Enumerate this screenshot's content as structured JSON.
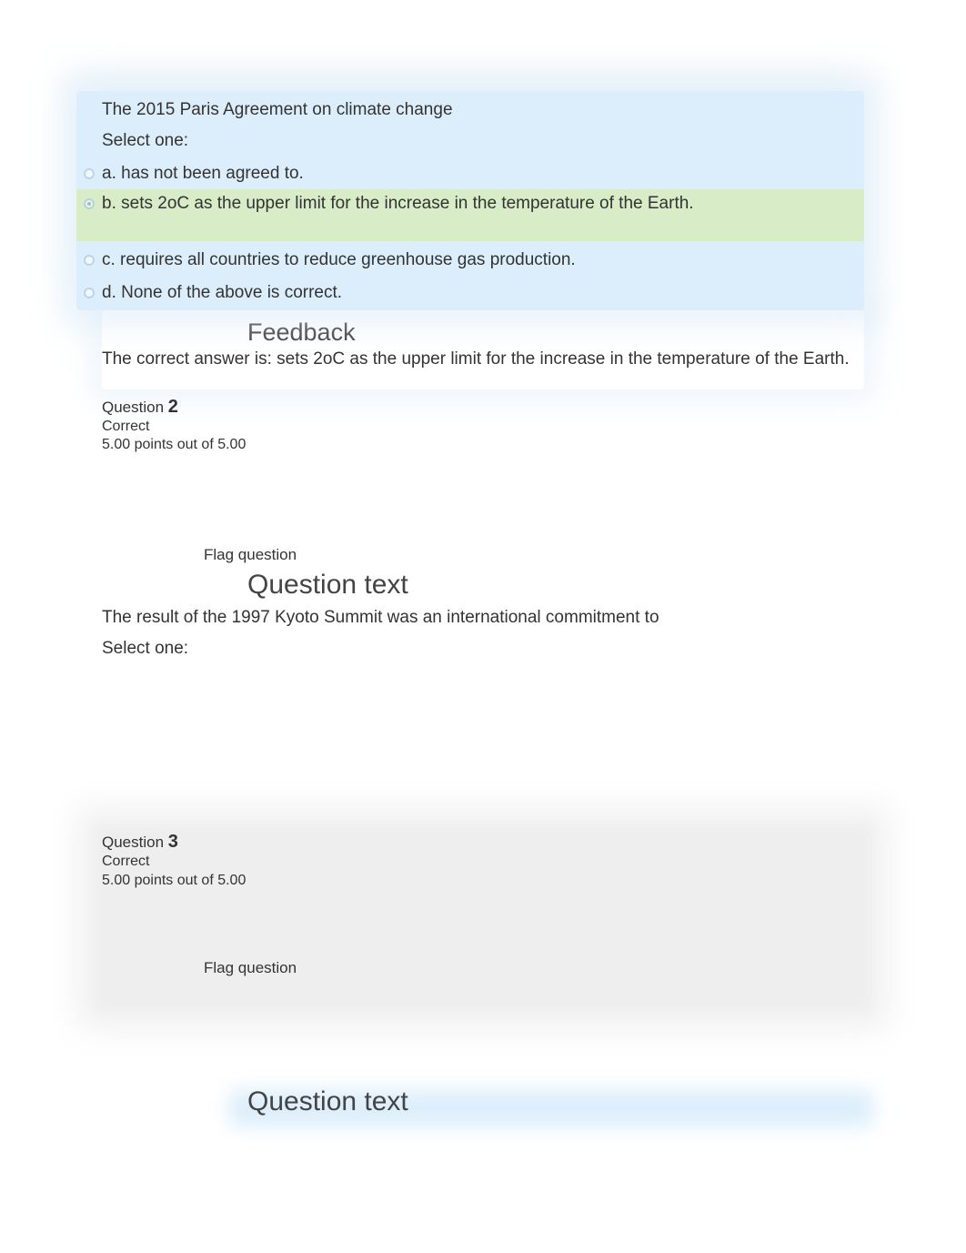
{
  "q1": {
    "prompt": "The 2015 Paris Agreement on climate change",
    "select": "Select one:",
    "options": {
      "a": "a. has not been agreed to.",
      "b": "b. sets 2oC as the upper limit for the increase in the temperature of the Earth.",
      "c": "c. requires all countries to reduce greenhouse gas production.",
      "d": "d. None of the above is correct."
    },
    "selected": "b",
    "feedback_title": "Feedback",
    "feedback_text": "The correct answer is: sets 2oC as the upper limit for the increase in the temperature of the Earth."
  },
  "q2": {
    "question_label": "Question",
    "number": "2",
    "status": "Correct",
    "points": "5.00 points out of 5.00",
    "flag": "Flag question",
    "section_title": "Question text",
    "prompt": "The result of the 1997 Kyoto Summit was an international commitment to",
    "select": "Select one:"
  },
  "q3": {
    "question_label": "Question",
    "number": "3",
    "status": "Correct",
    "points": "5.00 points out of 5.00",
    "flag": "Flag question",
    "section_title": "Question text"
  }
}
